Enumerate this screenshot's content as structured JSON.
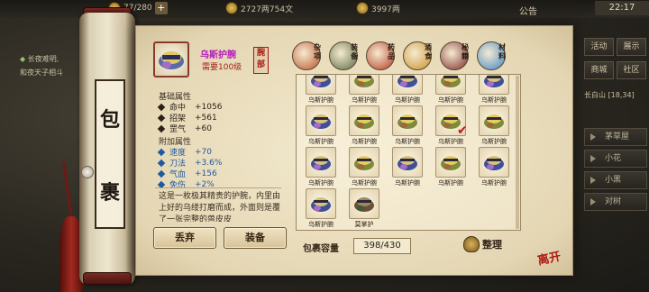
{
  "hud": {
    "resource1": "77/280",
    "resource2": "2727两754文",
    "resource3": "3997两",
    "notice": "公告",
    "clock": "22:17"
  },
  "chat": {
    "line1": "长夜难明,",
    "line2": "和夜天子相斗"
  },
  "right_panel": {
    "btn_activity": "活动",
    "btn_show": "展示",
    "btn_shop": "商城",
    "btn_social": "社区",
    "location": "长白山 [18,34]",
    "npc1": "茅草屋",
    "npc2": "小花",
    "npc3": "小黑",
    "npc4": "对树"
  },
  "window": {
    "title_char1": "包",
    "title_char2": "裹"
  },
  "item": {
    "name": "乌斯护腕",
    "requirement": "需要100级",
    "slot_seal": "腕部",
    "base_header": "基础属性",
    "base_stats": [
      {
        "label": "命中",
        "value": "+1056"
      },
      {
        "label": "招架",
        "value": "+561"
      },
      {
        "label": "罡气",
        "value": "+60"
      }
    ],
    "bonus_header": "附加属性",
    "bonus_stats": [
      {
        "label": "速度",
        "value": "+70"
      },
      {
        "label": "刀法",
        "value": "+3.6%"
      },
      {
        "label": "气血",
        "value": "+156"
      },
      {
        "label": "免伤",
        "value": "+2%"
      }
    ],
    "description": "这是一枚极其精贵的护腕，内里由上好的乌缕打磨而成，外面则是覆了一张完整的兽皮皮"
  },
  "buttons": {
    "discard": "丢弃",
    "equip": "装备",
    "sort": "整理"
  },
  "categories": [
    {
      "label": "杂项",
      "color": "#b8542a"
    },
    {
      "label": "装备",
      "color": "#5a6b40"
    },
    {
      "label": "药品",
      "color": "#b33a22"
    },
    {
      "label": "酒食",
      "color": "#c9902a"
    },
    {
      "label": "秘籍",
      "color": "#7a2a2a"
    },
    {
      "label": "材料",
      "color": "#3f86c8"
    }
  ],
  "inventory": {
    "items": [
      {
        "name": "乌斯护腕",
        "hue": "blue",
        "checked": false
      },
      {
        "name": "乌斯护腕",
        "hue": "gold",
        "checked": false
      },
      {
        "name": "乌斯护腕",
        "hue": "blue",
        "checked": false
      },
      {
        "name": "乌斯护腕",
        "hue": "gold",
        "checked": false
      },
      {
        "name": "乌斯护腕",
        "hue": "blue",
        "checked": false
      },
      {
        "name": "乌斯护腕",
        "hue": "blue",
        "checked": false
      },
      {
        "name": "乌斯护腕",
        "hue": "gold",
        "checked": false
      },
      {
        "name": "乌斯护腕",
        "hue": "gold",
        "checked": false
      },
      {
        "name": "乌斯护腕",
        "hue": "gold",
        "checked": true
      },
      {
        "name": "乌斯护腕",
        "hue": "gold",
        "checked": false
      },
      {
        "name": "乌斯护腕",
        "hue": "blue",
        "checked": false
      },
      {
        "name": "乌斯护腕",
        "hue": "gold",
        "checked": false
      },
      {
        "name": "乌斯护腕",
        "hue": "blue",
        "checked": false
      },
      {
        "name": "乌斯护腕",
        "hue": "gold",
        "checked": false
      },
      {
        "name": "乌斯护腕",
        "hue": "blue",
        "checked": false
      },
      {
        "name": "乌斯护腕",
        "hue": "blue",
        "checked": false
      },
      {
        "name": "莫掌护",
        "hue": "wood",
        "checked": false
      }
    ],
    "capacity_label": "包裹容量",
    "capacity": "398/430"
  },
  "brand": "离开"
}
